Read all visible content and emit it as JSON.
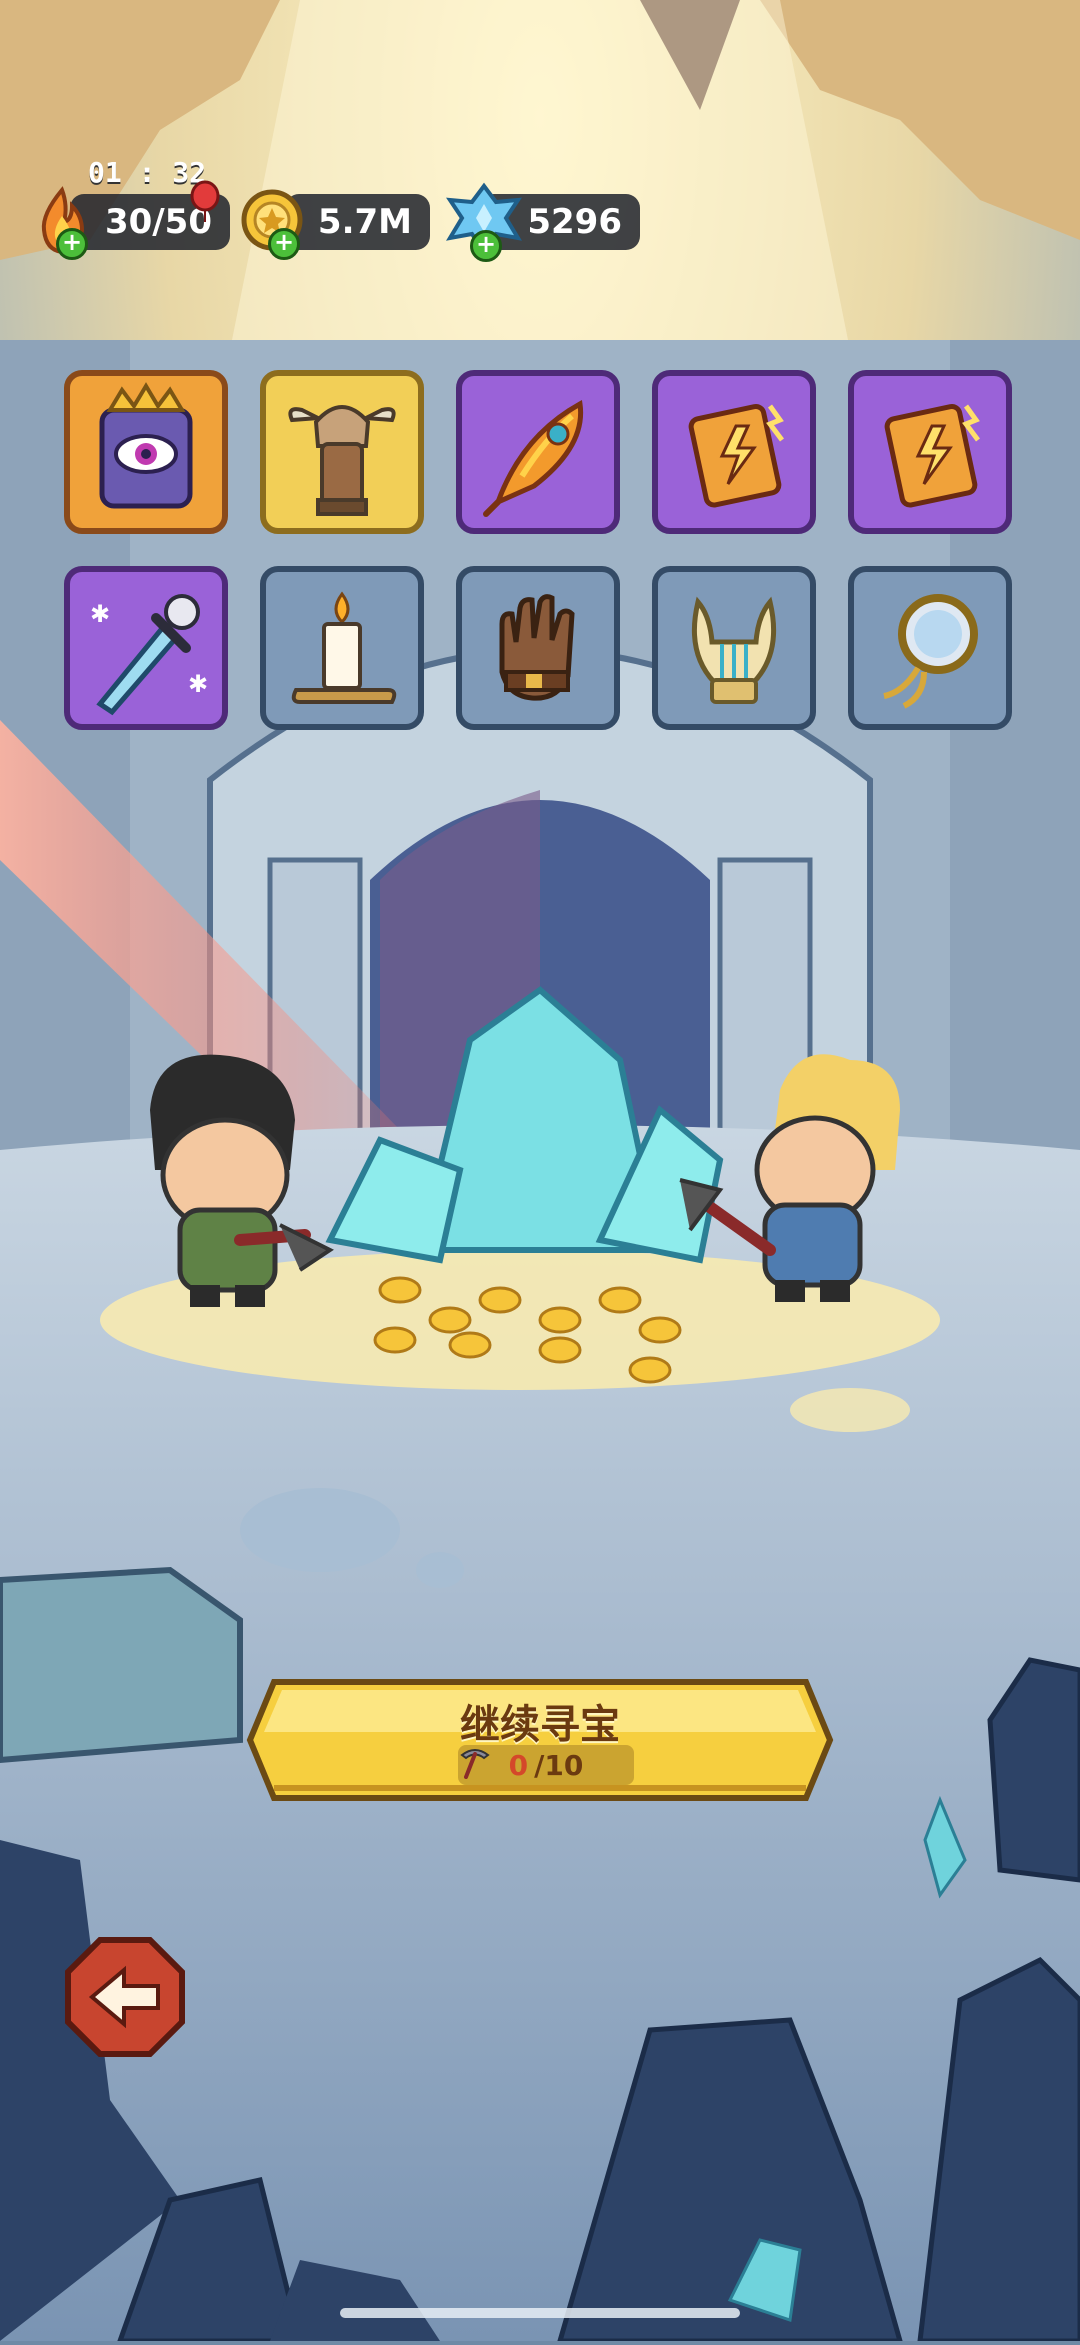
{
  "hud": {
    "timer": "01 : 32",
    "energy": "30/50",
    "gold": "5.7M",
    "gems": "5296",
    "icons": [
      "fire-energy-icon",
      "gold-coin-icon",
      "blue-gem-icon"
    ]
  },
  "items": [
    {
      "name": "eye-tome-icon",
      "rarity": "orange"
    },
    {
      "name": "totem-icon",
      "rarity": "yellow"
    },
    {
      "name": "phoenix-feather-icon",
      "rarity": "purple"
    },
    {
      "name": "thunder-book-icon",
      "rarity": "purple"
    },
    {
      "name": "thunder-book-icon",
      "rarity": "purple"
    },
    {
      "name": "frost-sword-icon",
      "rarity": "purple"
    },
    {
      "name": "candle-icon",
      "rarity": "blue"
    },
    {
      "name": "leather-glove-icon",
      "rarity": "blue"
    },
    {
      "name": "lyre-icon",
      "rarity": "blue"
    },
    {
      "name": "pocket-watch-icon",
      "rarity": "blue"
    }
  ],
  "main_button": {
    "label": "继续寻宝",
    "progress_current": "0",
    "progress_total": "/10",
    "progress": 0
  },
  "colors": {
    "button_yellow": "#f6cf3f",
    "button_text": "#6b3a10",
    "progress_current": "#d4482a",
    "back_button": "#c8452f"
  }
}
